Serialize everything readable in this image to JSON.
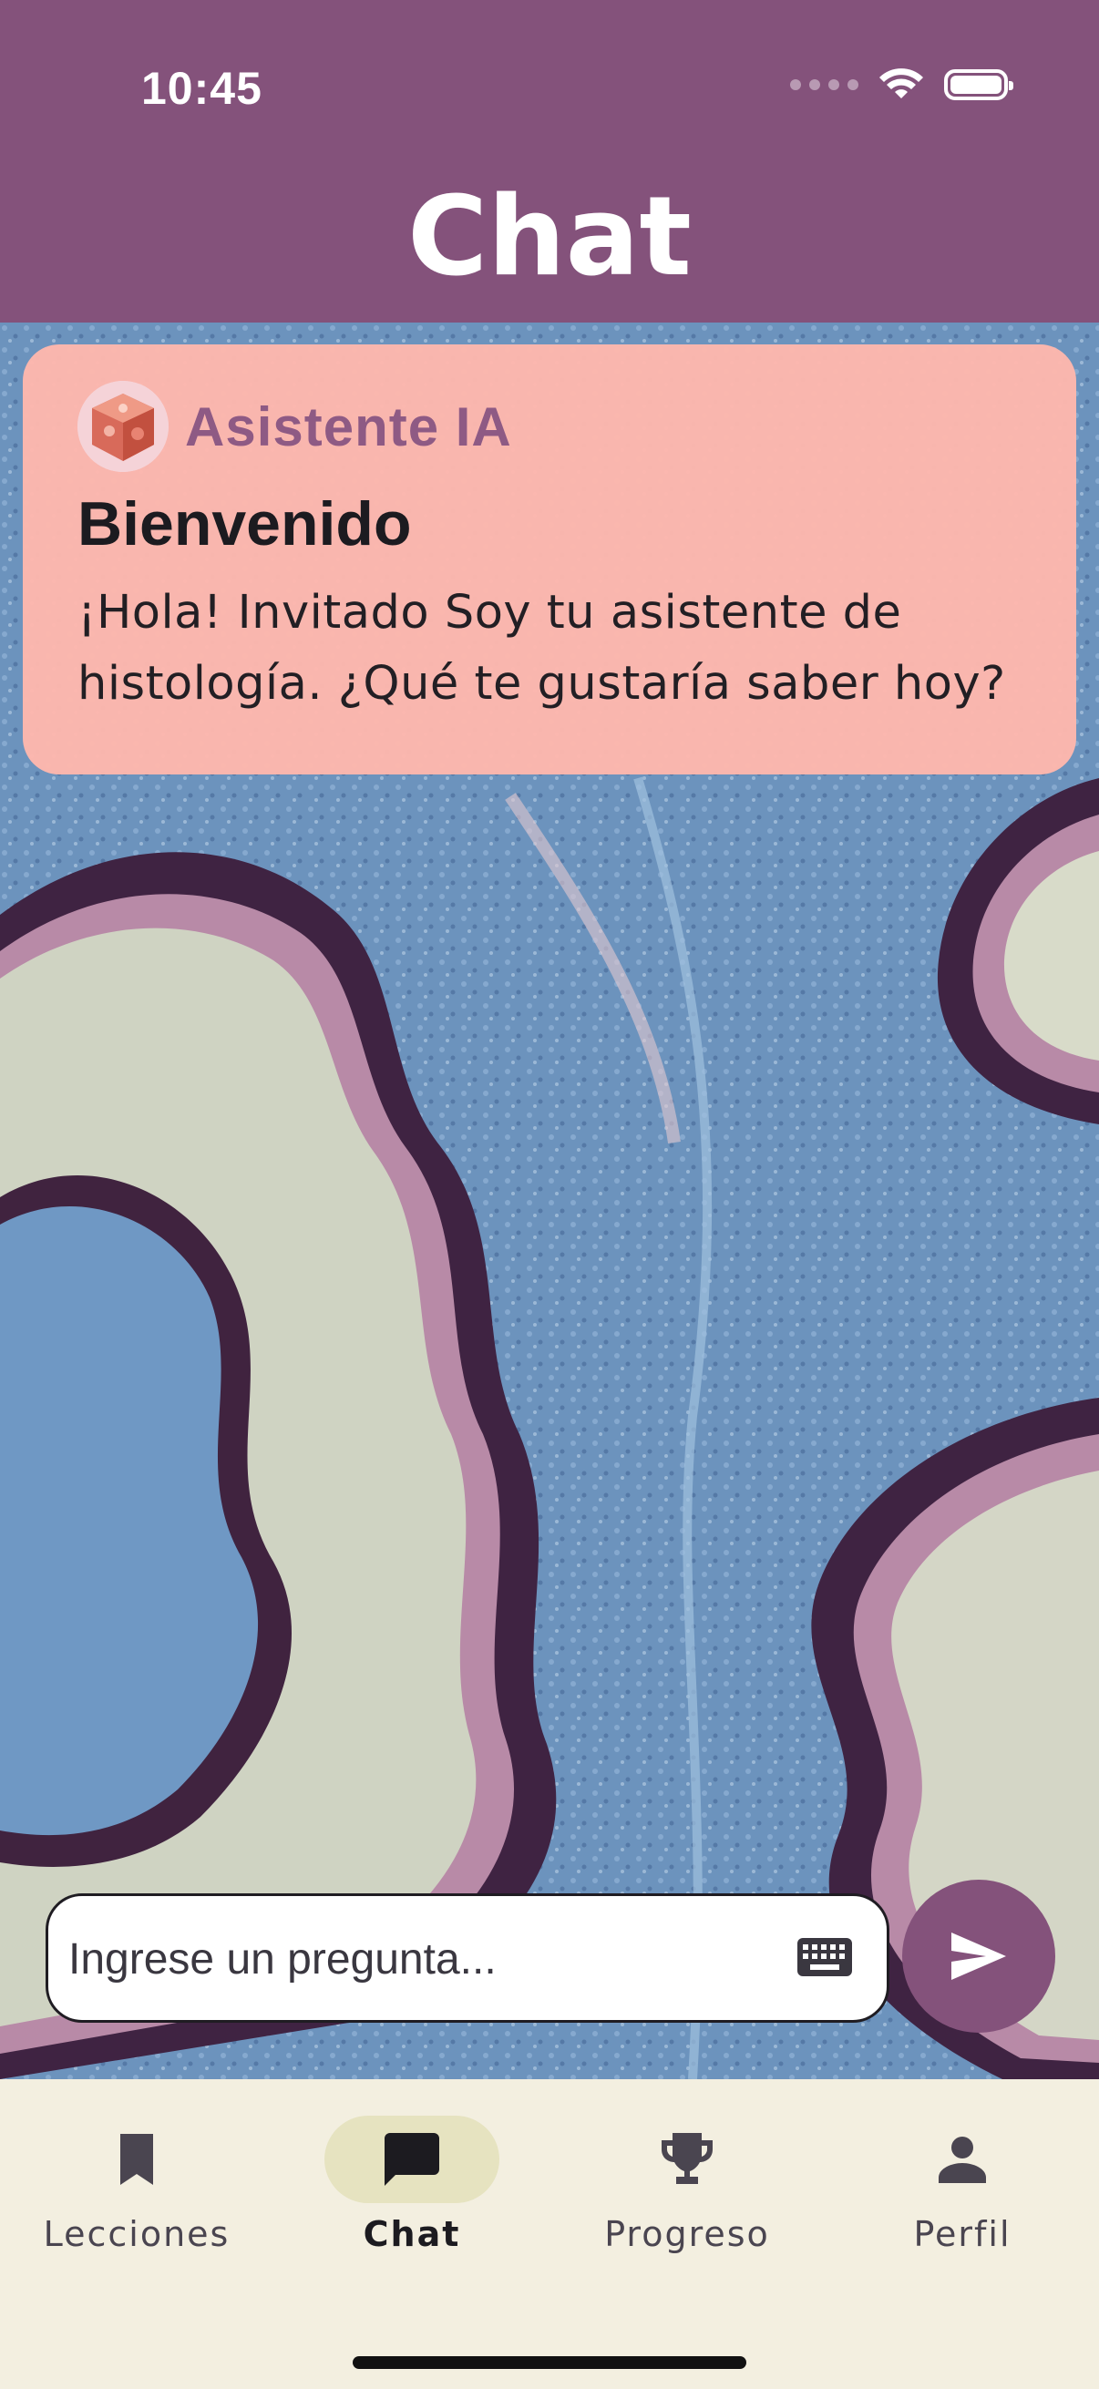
{
  "status_bar": {
    "time": "10:45"
  },
  "header": {
    "title": "Chat"
  },
  "message": {
    "assistant_name": "Asistente IA",
    "title": "Bienvenido",
    "text": "¡Hola! Invitado Soy tu asistente de histología. ¿Qué te gustaría saber hoy?"
  },
  "input": {
    "placeholder": "Ingrese un pregunta...",
    "value": ""
  },
  "nav": {
    "items": [
      {
        "label": "Lecciones",
        "icon": "bookmark-icon"
      },
      {
        "label": "Chat",
        "icon": "chat-icon",
        "active": true
      },
      {
        "label": "Progreso",
        "icon": "trophy-icon"
      },
      {
        "label": "Perfil",
        "icon": "person-icon"
      }
    ]
  },
  "colors": {
    "primary": "#84527b",
    "bubble": "#ffb7ad",
    "nav_bg": "#f3efe0",
    "active_pill": "#e6e3c0"
  }
}
